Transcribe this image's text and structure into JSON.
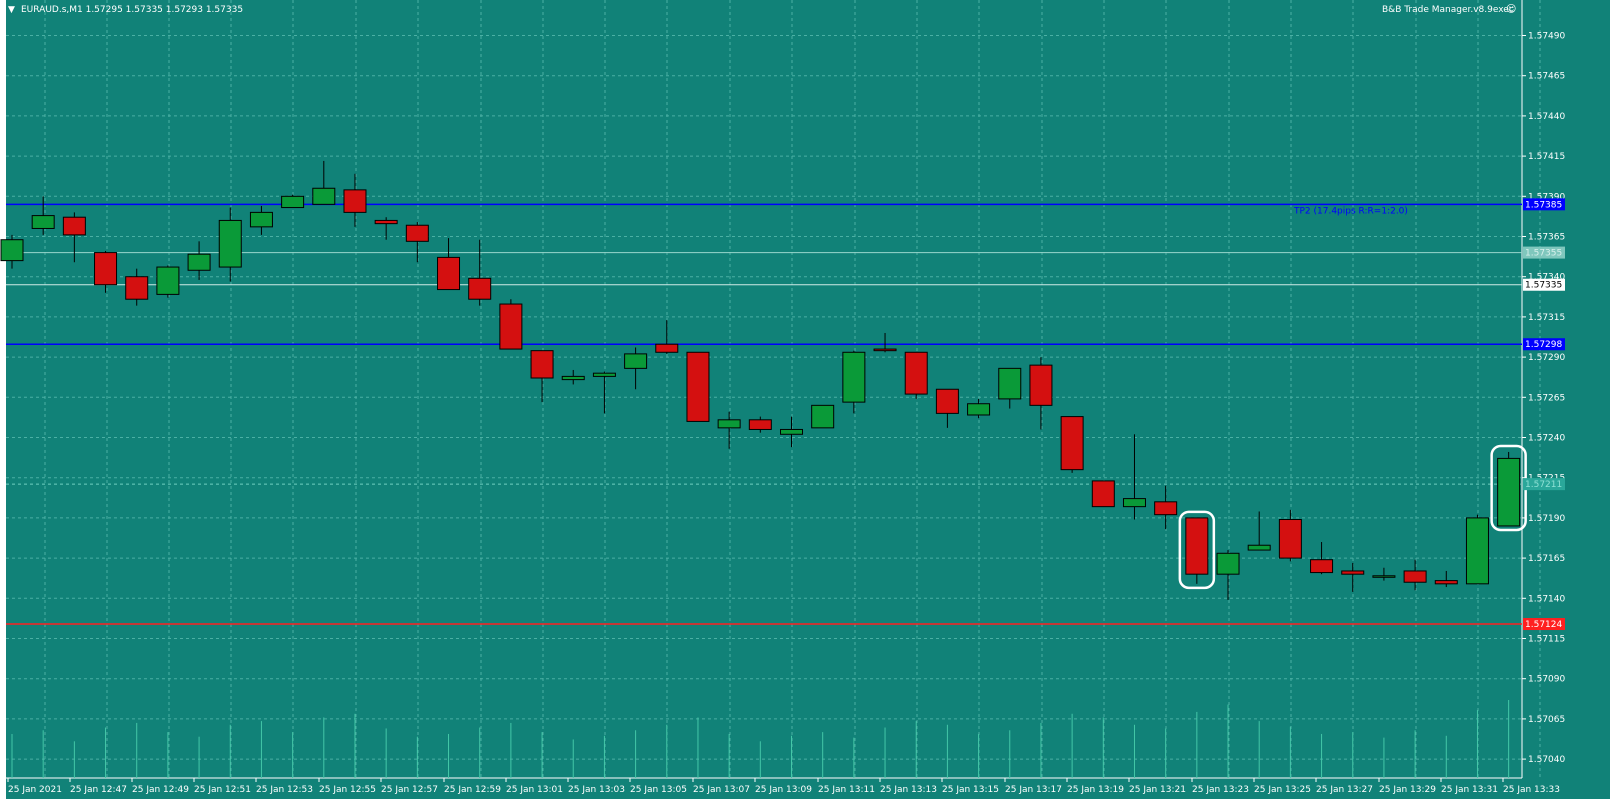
{
  "header": {
    "menu_arrow": "triangle-down-icon",
    "symbol_info": "EURAUD.s,M1  1.57295 1.57335 1.57293 1.57335",
    "ea_name": "B&B Trade Manager.v8.9exec",
    "ea_icon": "smiley-icon"
  },
  "colors": {
    "background": "#118278",
    "grid": "#4bb0a4",
    "bull": "#0a9a38",
    "bear": "#d41010",
    "wick": "#000000",
    "tp_line": "#0000ff",
    "sl_line": "#ff2020",
    "axis_text": "#ffffff",
    "annotation": "#ffffff"
  },
  "lines": {
    "tp2": {
      "price": 1.57385,
      "label": "1.57385",
      "caption": "TP2 (17.4pips R:R=1:2.0)"
    },
    "entry": {
      "price": 1.57298,
      "label": "1.57298"
    },
    "faint": {
      "price": 1.57355,
      "label": "1.57355"
    },
    "bid": {
      "price": 1.57335,
      "label": "1.57335"
    },
    "ask_dashed": {
      "price": 1.57211,
      "label": "1.57211"
    },
    "sl": {
      "price": 1.57124,
      "label": "1.57124"
    }
  },
  "chart_data": {
    "type": "candlestick",
    "symbol": "EURAUD.s",
    "timeframe": "M1",
    "y_ticks": [
      "1.57490",
      "1.57465",
      "1.57440",
      "1.57415",
      "1.57390",
      "1.57365",
      "1.57340",
      "1.57315",
      "1.57290",
      "1.57265",
      "1.57240",
      "1.57215",
      "1.57190",
      "1.57165",
      "1.57140",
      "1.57115",
      "1.57090",
      "1.57065",
      "1.57040"
    ],
    "x_ticks": [
      "25 Jan 2021",
      "25 Jan 12:47",
      "25 Jan 12:49",
      "25 Jan 12:51",
      "25 Jan 12:53",
      "25 Jan 12:55",
      "25 Jan 12:57",
      "25 Jan 12:59",
      "25 Jan 13:01",
      "25 Jan 13:03",
      "25 Jan 13:05",
      "25 Jan 13:07",
      "25 Jan 13:09",
      "25 Jan 13:11",
      "25 Jan 13:13",
      "25 Jan 13:15",
      "25 Jan 13:17",
      "25 Jan 13:19",
      "25 Jan 13:21",
      "25 Jan 13:23",
      "25 Jan 13:25",
      "25 Jan 13:27",
      "25 Jan 13:29",
      "25 Jan 13:31",
      "25 Jan 13:33"
    ],
    "ylim": [
      1.57033,
      1.57504
    ],
    "candles": [
      {
        "o": 1.5735,
        "h": 1.57366,
        "l": 1.57345,
        "c": 1.57363
      },
      {
        "o": 1.5737,
        "h": 1.5739,
        "l": 1.57366,
        "c": 1.57378
      },
      {
        "o": 1.57377,
        "h": 1.5738,
        "l": 1.57349,
        "c": 1.57366
      },
      {
        "o": 1.57355,
        "h": 1.57356,
        "l": 1.5733,
        "c": 1.57335
      },
      {
        "o": 1.5734,
        "h": 1.57345,
        "l": 1.57322,
        "c": 1.57326
      },
      {
        "o": 1.57329,
        "h": 1.57347,
        "l": 1.57327,
        "c": 1.57346
      },
      {
        "o": 1.57344,
        "h": 1.57362,
        "l": 1.57338,
        "c": 1.57354
      },
      {
        "o": 1.57346,
        "h": 1.57383,
        "l": 1.57337,
        "c": 1.57375
      },
      {
        "o": 1.57371,
        "h": 1.57384,
        "l": 1.57366,
        "c": 1.5738
      },
      {
        "o": 1.57383,
        "h": 1.57391,
        "l": 1.57383,
        "c": 1.5739
      },
      {
        "o": 1.57385,
        "h": 1.57412,
        "l": 1.57385,
        "c": 1.57395
      },
      {
        "o": 1.57394,
        "h": 1.57404,
        "l": 1.57371,
        "c": 1.5738
      },
      {
        "o": 1.57375,
        "h": 1.57377,
        "l": 1.57363,
        "c": 1.57373
      },
      {
        "o": 1.57372,
        "h": 1.57374,
        "l": 1.57349,
        "c": 1.57362
      },
      {
        "o": 1.57352,
        "h": 1.57364,
        "l": 1.57332,
        "c": 1.57332
      },
      {
        "o": 1.57339,
        "h": 1.57363,
        "l": 1.57322,
        "c": 1.57326
      },
      {
        "o": 1.57323,
        "h": 1.57326,
        "l": 1.57295,
        "c": 1.57295
      },
      {
        "o": 1.57294,
        "h": 1.57294,
        "l": 1.57262,
        "c": 1.57277
      },
      {
        "o": 1.57276,
        "h": 1.57282,
        "l": 1.57273,
        "c": 1.57278
      },
      {
        "o": 1.57278,
        "h": 1.57281,
        "l": 1.57255,
        "c": 1.5728
      },
      {
        "o": 1.57283,
        "h": 1.57296,
        "l": 1.5727,
        "c": 1.57292
      },
      {
        "o": 1.57298,
        "h": 1.57313,
        "l": 1.57292,
        "c": 1.57293
      },
      {
        "o": 1.57293,
        "h": 1.57293,
        "l": 1.5725,
        "c": 1.5725
      },
      {
        "o": 1.57246,
        "h": 1.57256,
        "l": 1.57233,
        "c": 1.57251
      },
      {
        "o": 1.57251,
        "h": 1.57253,
        "l": 1.57243,
        "c": 1.57245
      },
      {
        "o": 1.57242,
        "h": 1.57253,
        "l": 1.57234,
        "c": 1.57245
      },
      {
        "o": 1.57246,
        "h": 1.5726,
        "l": 1.57246,
        "c": 1.5726
      },
      {
        "o": 1.57262,
        "h": 1.57294,
        "l": 1.57255,
        "c": 1.57293
      },
      {
        "o": 1.57295,
        "h": 1.57305,
        "l": 1.57293,
        "c": 1.57294
      },
      {
        "o": 1.57293,
        "h": 1.57293,
        "l": 1.57264,
        "c": 1.57267
      },
      {
        "o": 1.5727,
        "h": 1.5727,
        "l": 1.57246,
        "c": 1.57255
      },
      {
        "o": 1.57254,
        "h": 1.57264,
        "l": 1.57252,
        "c": 1.57261
      },
      {
        "o": 1.57264,
        "h": 1.57283,
        "l": 1.57258,
        "c": 1.57283
      },
      {
        "o": 1.57285,
        "h": 1.5729,
        "l": 1.57245,
        "c": 1.5726
      },
      {
        "o": 1.57253,
        "h": 1.57253,
        "l": 1.57218,
        "c": 1.5722
      },
      {
        "o": 1.57213,
        "h": 1.57213,
        "l": 1.57197,
        "c": 1.57197
      },
      {
        "o": 1.57197,
        "h": 1.57242,
        "l": 1.57189,
        "c": 1.57202
      },
      {
        "o": 1.572,
        "h": 1.5721,
        "l": 1.57183,
        "c": 1.57192
      },
      {
        "o": 1.5719,
        "h": 1.5719,
        "l": 1.57149,
        "c": 1.57155
      },
      {
        "o": 1.57155,
        "h": 1.5717,
        "l": 1.57139,
        "c": 1.57168
      },
      {
        "o": 1.5717,
        "h": 1.57194,
        "l": 1.5717,
        "c": 1.57173
      },
      {
        "o": 1.57189,
        "h": 1.57195,
        "l": 1.57163,
        "c": 1.57165
      },
      {
        "o": 1.57164,
        "h": 1.57175,
        "l": 1.57155,
        "c": 1.57156
      },
      {
        "o": 1.57157,
        "h": 1.57162,
        "l": 1.57144,
        "c": 1.57155
      },
      {
        "o": 1.57154,
        "h": 1.57159,
        "l": 1.57151,
        "c": 1.57154
      },
      {
        "o": 1.57157,
        "h": 1.57164,
        "l": 1.57145,
        "c": 1.5715
      },
      {
        "o": 1.57151,
        "h": 1.57157,
        "l": 1.57147,
        "c": 1.57149
      },
      {
        "o": 1.57149,
        "h": 1.57192,
        "l": 1.57149,
        "c": 1.5719
      },
      {
        "o": 1.57185,
        "h": 1.57231,
        "l": 1.57185,
        "c": 1.57227
      }
    ],
    "volumes": [
      48,
      52,
      40,
      55,
      60,
      50,
      45,
      58,
      62,
      50,
      66,
      70,
      54,
      45,
      48,
      55,
      60,
      50,
      42,
      46,
      52,
      58,
      66,
      48,
      40,
      46,
      50,
      44,
      55,
      62,
      58,
      48,
      52,
      60,
      70,
      66,
      58,
      54,
      72,
      80,
      62,
      56,
      48,
      50,
      44,
      52,
      46,
      74,
      85
    ],
    "annotations": [
      {
        "type": "hand-drawn-circle",
        "candle_index": 38
      },
      {
        "type": "hand-drawn-circle",
        "candle_index": 48
      }
    ]
  }
}
